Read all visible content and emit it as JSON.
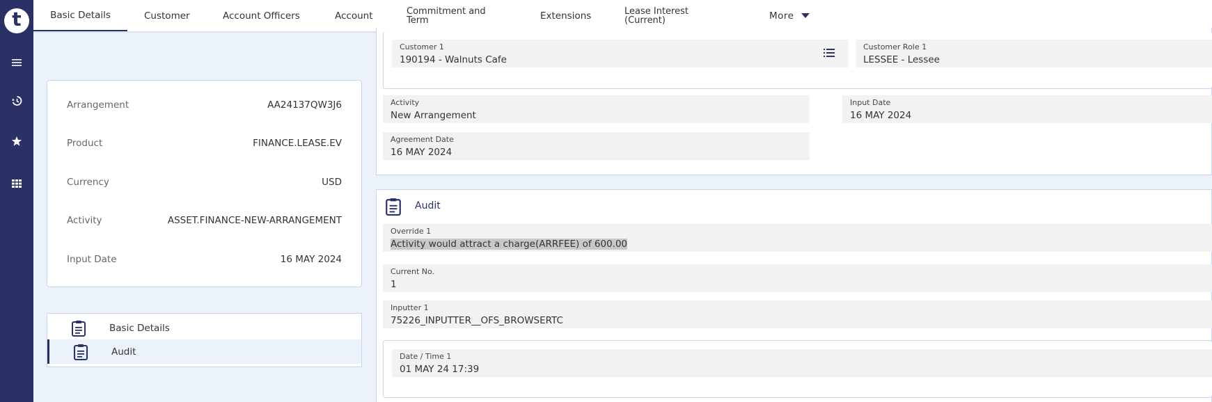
{
  "rail": {
    "logo_letter": "t",
    "icons": [
      "menu-icon",
      "history-icon",
      "star-icon",
      "apps-grid-icon"
    ]
  },
  "tabs": [
    {
      "label": "Basic Details",
      "active": true
    },
    {
      "label": "Customer"
    },
    {
      "label": "Account Officers"
    },
    {
      "label": "Account"
    },
    {
      "label": "Commitment and Term"
    },
    {
      "label": "Extensions"
    },
    {
      "label": "Lease Interest (Current)"
    },
    {
      "label": "More"
    }
  ],
  "summary": [
    {
      "key": "Arrangement",
      "value": "AA24137QW3J6"
    },
    {
      "key": "Product",
      "value": "FINANCE.LEASE.EV"
    },
    {
      "key": "Currency",
      "value": "USD"
    },
    {
      "key": "Activity",
      "value": "ASSET.FINANCE-NEW-ARRANGEMENT"
    },
    {
      "key": "Input Date",
      "value": "16 MAY 2024"
    }
  ],
  "nav": [
    {
      "label": "Basic Details",
      "icon": "clipboard-icon"
    },
    {
      "label": "Audit",
      "icon": "clipboard-icon",
      "active": true
    }
  ],
  "basic": {
    "customer": {
      "label": "Customer 1",
      "value": "190194 - Walnuts Cafe"
    },
    "customer_role": {
      "label": "Customer Role 1",
      "value": "LESSEE - Lessee"
    },
    "activity": {
      "label": "Activity",
      "value": "New Arrangement"
    },
    "input_date": {
      "label": "Input Date",
      "value": "16 MAY 2024"
    },
    "agreement_date": {
      "label": "Agreement Date",
      "value": "16 MAY 2024"
    }
  },
  "audit": {
    "title": "Audit",
    "override": {
      "label": "Override 1",
      "value": "Activity would attract a charge(ARRFEE) of 600.00"
    },
    "current_no": {
      "label": "Current No.",
      "value": "1"
    },
    "inputter": {
      "label": "Inputter 1",
      "value": "75226_INPUTTER__OFS_BROWSERTC"
    },
    "datetime": {
      "label": "Date / Time 1",
      "value": "01 MAY 24 17:39"
    }
  },
  "colors": {
    "rail": "#2b3164",
    "background": "#ebf2fc",
    "field": "#f2f2f2",
    "accent": "#2b3164"
  }
}
